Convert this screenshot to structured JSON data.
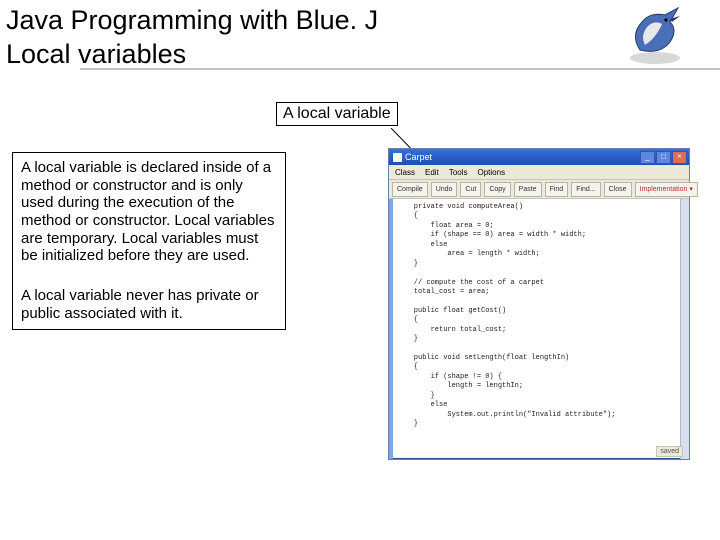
{
  "header": {
    "title_line1": "Java Programming with Blue. J",
    "title_line2": "Local variables"
  },
  "callout": {
    "label": "A local variable"
  },
  "explain": {
    "p1": "A local variable is declared inside of a method or constructor and is only used during the execution of the method or constructor. Local variables are temporary. Local variables must be initialized before they are used.",
    "p2": "A local variable never has private or public associated with it."
  },
  "editor": {
    "title": "Carpet",
    "menus": [
      "Class",
      "Edit",
      "Tools",
      "Options"
    ],
    "toolbar": [
      "Compile",
      "Undo",
      "Cut",
      "Copy",
      "Paste",
      "Find",
      "Find...",
      "Close"
    ],
    "mode": "Implementation",
    "code_lines": [
      "    private void computeArea()",
      "    {",
      "        float area = 0;",
      "        if (shape == 0) area = width * width;",
      "        else",
      "            area = length * width;",
      "    }",
      "",
      "    // compute the cost of a carpet",
      "    total_cost = area;",
      "",
      "    public float getCost()",
      "    {",
      "        return total_cost;",
      "    }",
      "",
      "    public void setLength(float lengthIn)",
      "    {",
      "        if (shape != 0) {",
      "            length = lengthIn;",
      "        }",
      "        else",
      "            System.out.println(\"Invalid attribute\");",
      "    }"
    ],
    "status": "saved",
    "win_buttons": {
      "min": "_",
      "max": "□",
      "close": "×"
    }
  }
}
